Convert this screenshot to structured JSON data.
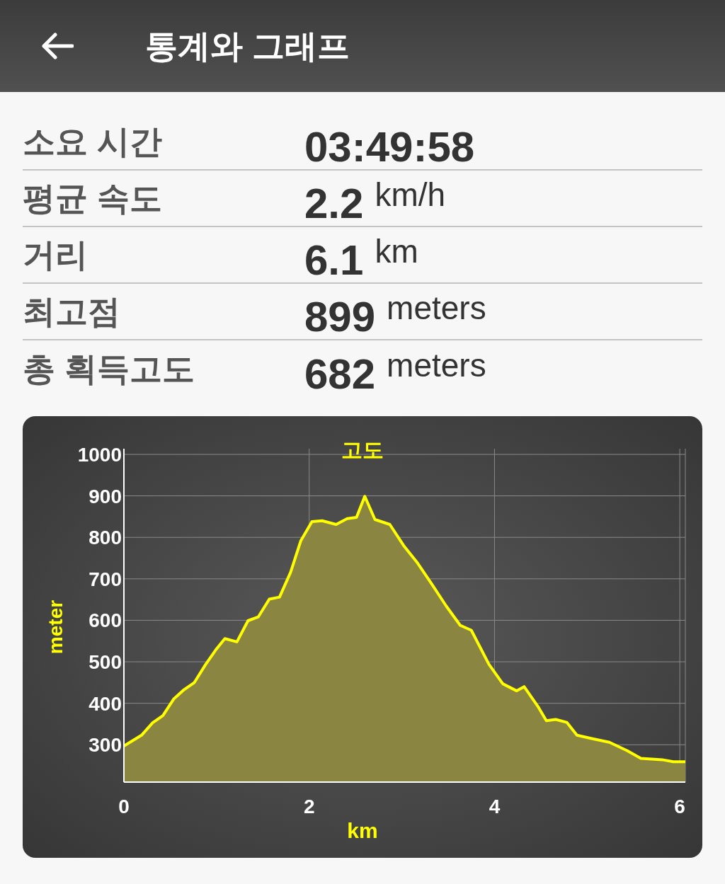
{
  "header": {
    "title": "통계와 그래프"
  },
  "stats": [
    {
      "label": "소요 시간",
      "value": "03:49:58"
    },
    {
      "label": "평균 속도",
      "value": "2.2",
      "unit": "km/h"
    },
    {
      "label": "거리",
      "value": "6.1",
      "unit": "km"
    },
    {
      "label": "최고점",
      "value": "899",
      "unit": "meters"
    },
    {
      "label": "총 획득고도",
      "value": "682",
      "unit": "meters"
    }
  ],
  "elevation": {
    "chart_data": {
      "type": "area",
      "title": "고도",
      "xlabel": "km",
      "ylabel": "meter",
      "x": [
        0,
        0.19,
        0.31,
        0.42,
        0.54,
        0.65,
        0.76,
        0.88,
        0.99,
        1.09,
        1.22,
        1.34,
        1.45,
        1.57,
        1.68,
        1.8,
        1.91,
        2.03,
        2.14,
        2.29,
        2.41,
        2.51,
        2.6,
        2.71,
        2.87,
        3.02,
        3.17,
        3.33,
        3.48,
        3.63,
        3.75,
        3.94,
        4.09,
        4.24,
        4.32,
        4.47,
        4.56,
        4.66,
        4.78,
        4.89,
        5.05,
        5.24,
        5.43,
        5.58,
        5.81,
        5.93,
        6.06
      ],
      "series": [
        {
          "color": "#ffff00",
          "values": [
            297,
            323,
            353,
            370,
            411,
            433,
            450,
            493,
            528,
            556,
            548,
            599,
            608,
            651,
            656,
            716,
            792,
            838,
            840,
            831,
            845,
            848,
            899,
            843,
            831,
            780,
            738,
            685,
            634,
            588,
            576,
            494,
            447,
            430,
            440,
            392,
            358,
            361,
            354,
            323,
            315,
            306,
            286,
            267,
            264,
            259,
            259
          ]
        }
      ],
      "grid": true,
      "xlim": [
        0,
        6.06
      ],
      "ylim": [
        210,
        1000
      ],
      "xticks": [
        0,
        2,
        4,
        6
      ],
      "yticks": [
        300,
        400,
        500,
        600,
        700,
        800,
        900,
        1000
      ]
    }
  }
}
